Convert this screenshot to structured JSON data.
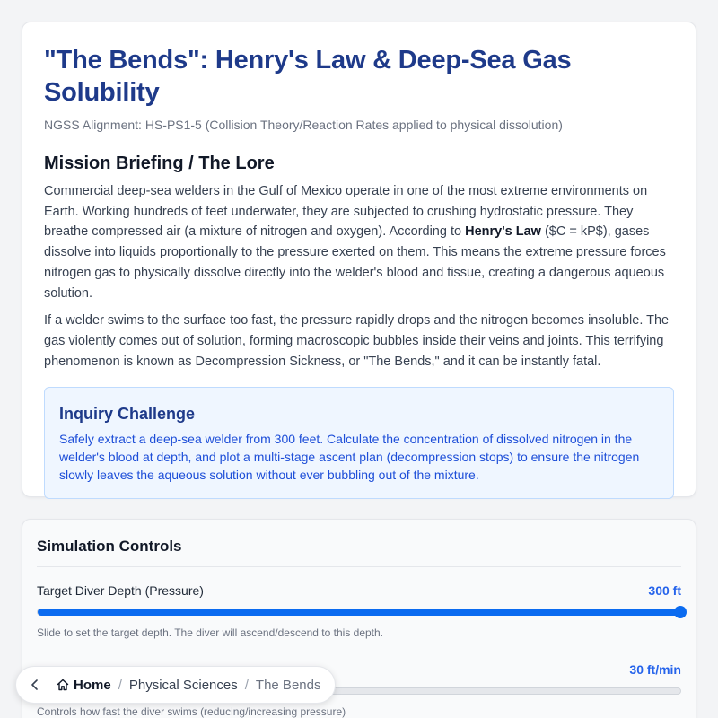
{
  "header": {
    "title": "\"The Bends\": Henry's Law & Deep-Sea Gas Solubility",
    "alignment": "NGSS Alignment: HS-PS1-5 (Collision Theory/Reaction Rates applied to physical dissolution)"
  },
  "briefing": {
    "heading": "Mission Briefing / The Lore",
    "p1_before": "Commercial deep-sea welders in the Gulf of Mexico operate in one of the most extreme environments on Earth. Working hundreds of feet underwater, they are subjected to crushing hydrostatic pressure. They breathe compressed air (a mixture of nitrogen and oxygen). According to ",
    "p1_bold": "Henry's Law",
    "p1_after": " ($C = kP$), gases dissolve into liquids proportionally to the pressure exerted on them. This means the extreme pressure forces nitrogen gas to physically dissolve directly into the welder's blood and tissue, creating a dangerous aqueous solution.",
    "p2": "If a welder swims to the surface too fast, the pressure rapidly drops and the nitrogen becomes insoluble. The gas violently comes out of solution, forming macroscopic bubbles inside their veins and joints. This terrifying phenomenon is known as Decompression Sickness, or \"The Bends,\" and it can be instantly fatal."
  },
  "inquiry": {
    "title": "Inquiry Challenge",
    "text": "Safely extract a deep-sea welder from 300 feet. Calculate the concentration of dissolved nitrogen in the welder's blood at depth, and plot a multi-stage ascent plan (decompression stops) to ensure the nitrogen slowly leaves the aqueous solution without ever bubbling out of the mixture."
  },
  "controls": {
    "title": "Simulation Controls",
    "depth": {
      "label": "Target Diver Depth (Pressure)",
      "value": "300 ft",
      "fraction": 1.0,
      "hint": "Slide to set the target depth. The diver will ascend/descend to this depth."
    },
    "speed": {
      "value": "30 ft/min",
      "fraction": 0.0,
      "hint": "Controls how fast the diver swims (reducing/increasing pressure)"
    }
  },
  "breadcrumb": {
    "home": "Home",
    "sep": "/",
    "section": "Physical Sciences",
    "current": "The Bends"
  },
  "colors": {
    "accent": "#0b6bf0",
    "title": "#1e3a8a"
  }
}
